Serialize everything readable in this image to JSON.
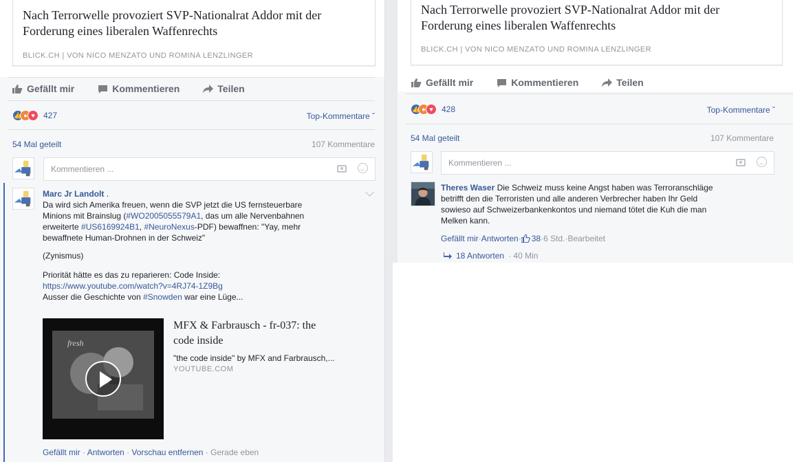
{
  "post": {
    "link_title_line1": "Nach Terrorwelle provoziert SVP-Nationalrat Addor mit der",
    "link_title_line2": "Forderung eines liberalen Waffenrechts",
    "link_source": "BLICK.CH | VON NICO MENZATO UND ROMINA LENZLINGER"
  },
  "actions": {
    "like": "Gefällt mir",
    "comment": "Kommentieren",
    "share": "Teilen"
  },
  "left": {
    "reaction_count": "427",
    "sort_label": "Top-Kommentare ˇ",
    "shares": "54 Mal geteilt",
    "comment_count": "107 Kommentare",
    "comment_placeholder": "Kommentieren ...",
    "comment": {
      "author": "Marc Jr Landolt",
      "after_author": " .",
      "line1": "Da wird sich Amerika freuen, wenn die SVP jetzt die US fernsteuerbare",
      "line2_pre": "Minions mit Brainslug (",
      "line2_hash": "#WO2005055579A1",
      "line2_post": ", das um alle Nervenbahnen",
      "line3_pre": "erweiterte ",
      "line3_hash1": "#US6169924B1",
      "line3_mid": ", ",
      "line3_hash2": "#NeuroNexus",
      "line3_post": "-PDF) bewaffnen: \"Yay, mehr",
      "line4": "bewaffnete Human-Drohnen in der Schweiz\"",
      "para2": "(Zynismus)",
      "para3_line1": "Priorität hätte es das zu reparieren: Code Inside:",
      "para3_link": "https://www.youtube.com/watch?v=4RJ74-1Z9Bg",
      "para3_line3_pre": "Ausser die Geschichte von ",
      "para3_line3_hash": "#Snowden",
      "para3_line3_post": " war eine Lüge..."
    },
    "video": {
      "title_line1": "MFX & Farbrausch - fr-037: the",
      "title_line2": "code inside",
      "desc": "\"the code inside\" by MFX and Farbrausch,...",
      "source": "YOUTUBE.COM"
    },
    "meta": {
      "like": "Gefällt mir",
      "reply": "Antworten",
      "remove_preview": "Vorschau entfernen",
      "time": "Gerade eben",
      "sep": " · "
    }
  },
  "right": {
    "reaction_count": "428",
    "sort_label": "Top-Kommentare ˇ",
    "shares": "54 Mal geteilt",
    "comment_count": "107 Kommentare",
    "comment_placeholder": "Kommentieren ...",
    "comment": {
      "author": "Theres Waser",
      "line1": " Die Schweiz muss keine Angst haben was Terroranschläge",
      "line2": "betrifft den die Terroristen und alle anderen Verbrecher haben Ihr Geld",
      "line3": "sowieso auf Schweizerbankenkontos und niemand tötet die Kuh die man",
      "line4": "Melken kann."
    },
    "meta": {
      "like": "Gefällt mir",
      "reply": "Antworten",
      "likes": "38",
      "time": "6 Std.",
      "edited": "Bearbeitet",
      "sep": " · "
    },
    "replies": {
      "label": "18 Antworten",
      "time": "· 40 Min"
    }
  },
  "colors": {
    "link": "#365899",
    "meta": "#90949c",
    "like_reaction": "#4267b2",
    "angry_reaction": "#f0883a",
    "love_reaction": "#ed4e5e"
  },
  "icons": [
    "thumbs-up-icon",
    "comment-bubble-icon",
    "share-arrow-icon",
    "camera-icon",
    "emoji-icon",
    "chevron-down-icon",
    "play-icon",
    "reply-arrow-icon"
  ]
}
